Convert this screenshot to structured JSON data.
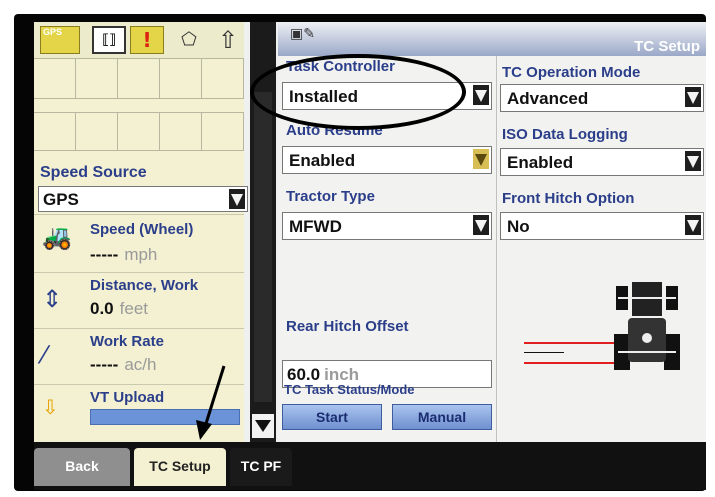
{
  "status_icons": {
    "gps_label": "GPS",
    "device_icon": "device-icon",
    "warning_icon": "warning-icon",
    "warning_glyph": "!",
    "tag_icon": "tag-icon",
    "up_icon": "up-arrow-icon"
  },
  "left_panel": {
    "speed_source_label": "Speed Source",
    "speed_source_value": "GPS",
    "speed": {
      "label": "Speed (Wheel)",
      "value": "-----",
      "unit": "mph"
    },
    "distance": {
      "label": "Distance, Work",
      "value": "0.0",
      "unit": "feet"
    },
    "work_rate": {
      "label": "Work Rate",
      "value": "-----",
      "unit": "ac/h"
    },
    "vt_upload": {
      "label": "VT Upload"
    }
  },
  "right_panel": {
    "title": "TC Setup",
    "task_controller": {
      "label": "Task Controller",
      "value": "Installed"
    },
    "auto_resume": {
      "label": "Auto Resume",
      "value": "Enabled"
    },
    "tractor_type": {
      "label": "Tractor Type",
      "value": "MFWD"
    },
    "tc_operation_mode": {
      "label": "TC Operation Mode",
      "value": "Advanced"
    },
    "iso_data_logging": {
      "label": "ISO Data Logging",
      "value": "Enabled"
    },
    "front_hitch_option": {
      "label": "Front Hitch Option",
      "value": "No"
    },
    "rear_hitch_offset": {
      "label": "Rear Hitch Offset",
      "value": "60.0",
      "unit": "inch"
    },
    "task_status": {
      "label": "TC Task Status/Mode",
      "start_label": "Start",
      "manual_label": "Manual"
    }
  },
  "tabs": {
    "back": "Back",
    "tc_setup": "TC Setup",
    "tc_pf": "TC PF"
  },
  "colors": {
    "label_blue": "#2b3e8a",
    "panel_yellow": "#f3f1d2",
    "button_blue": "#6f90d0",
    "hitch_red": "#e02020"
  }
}
